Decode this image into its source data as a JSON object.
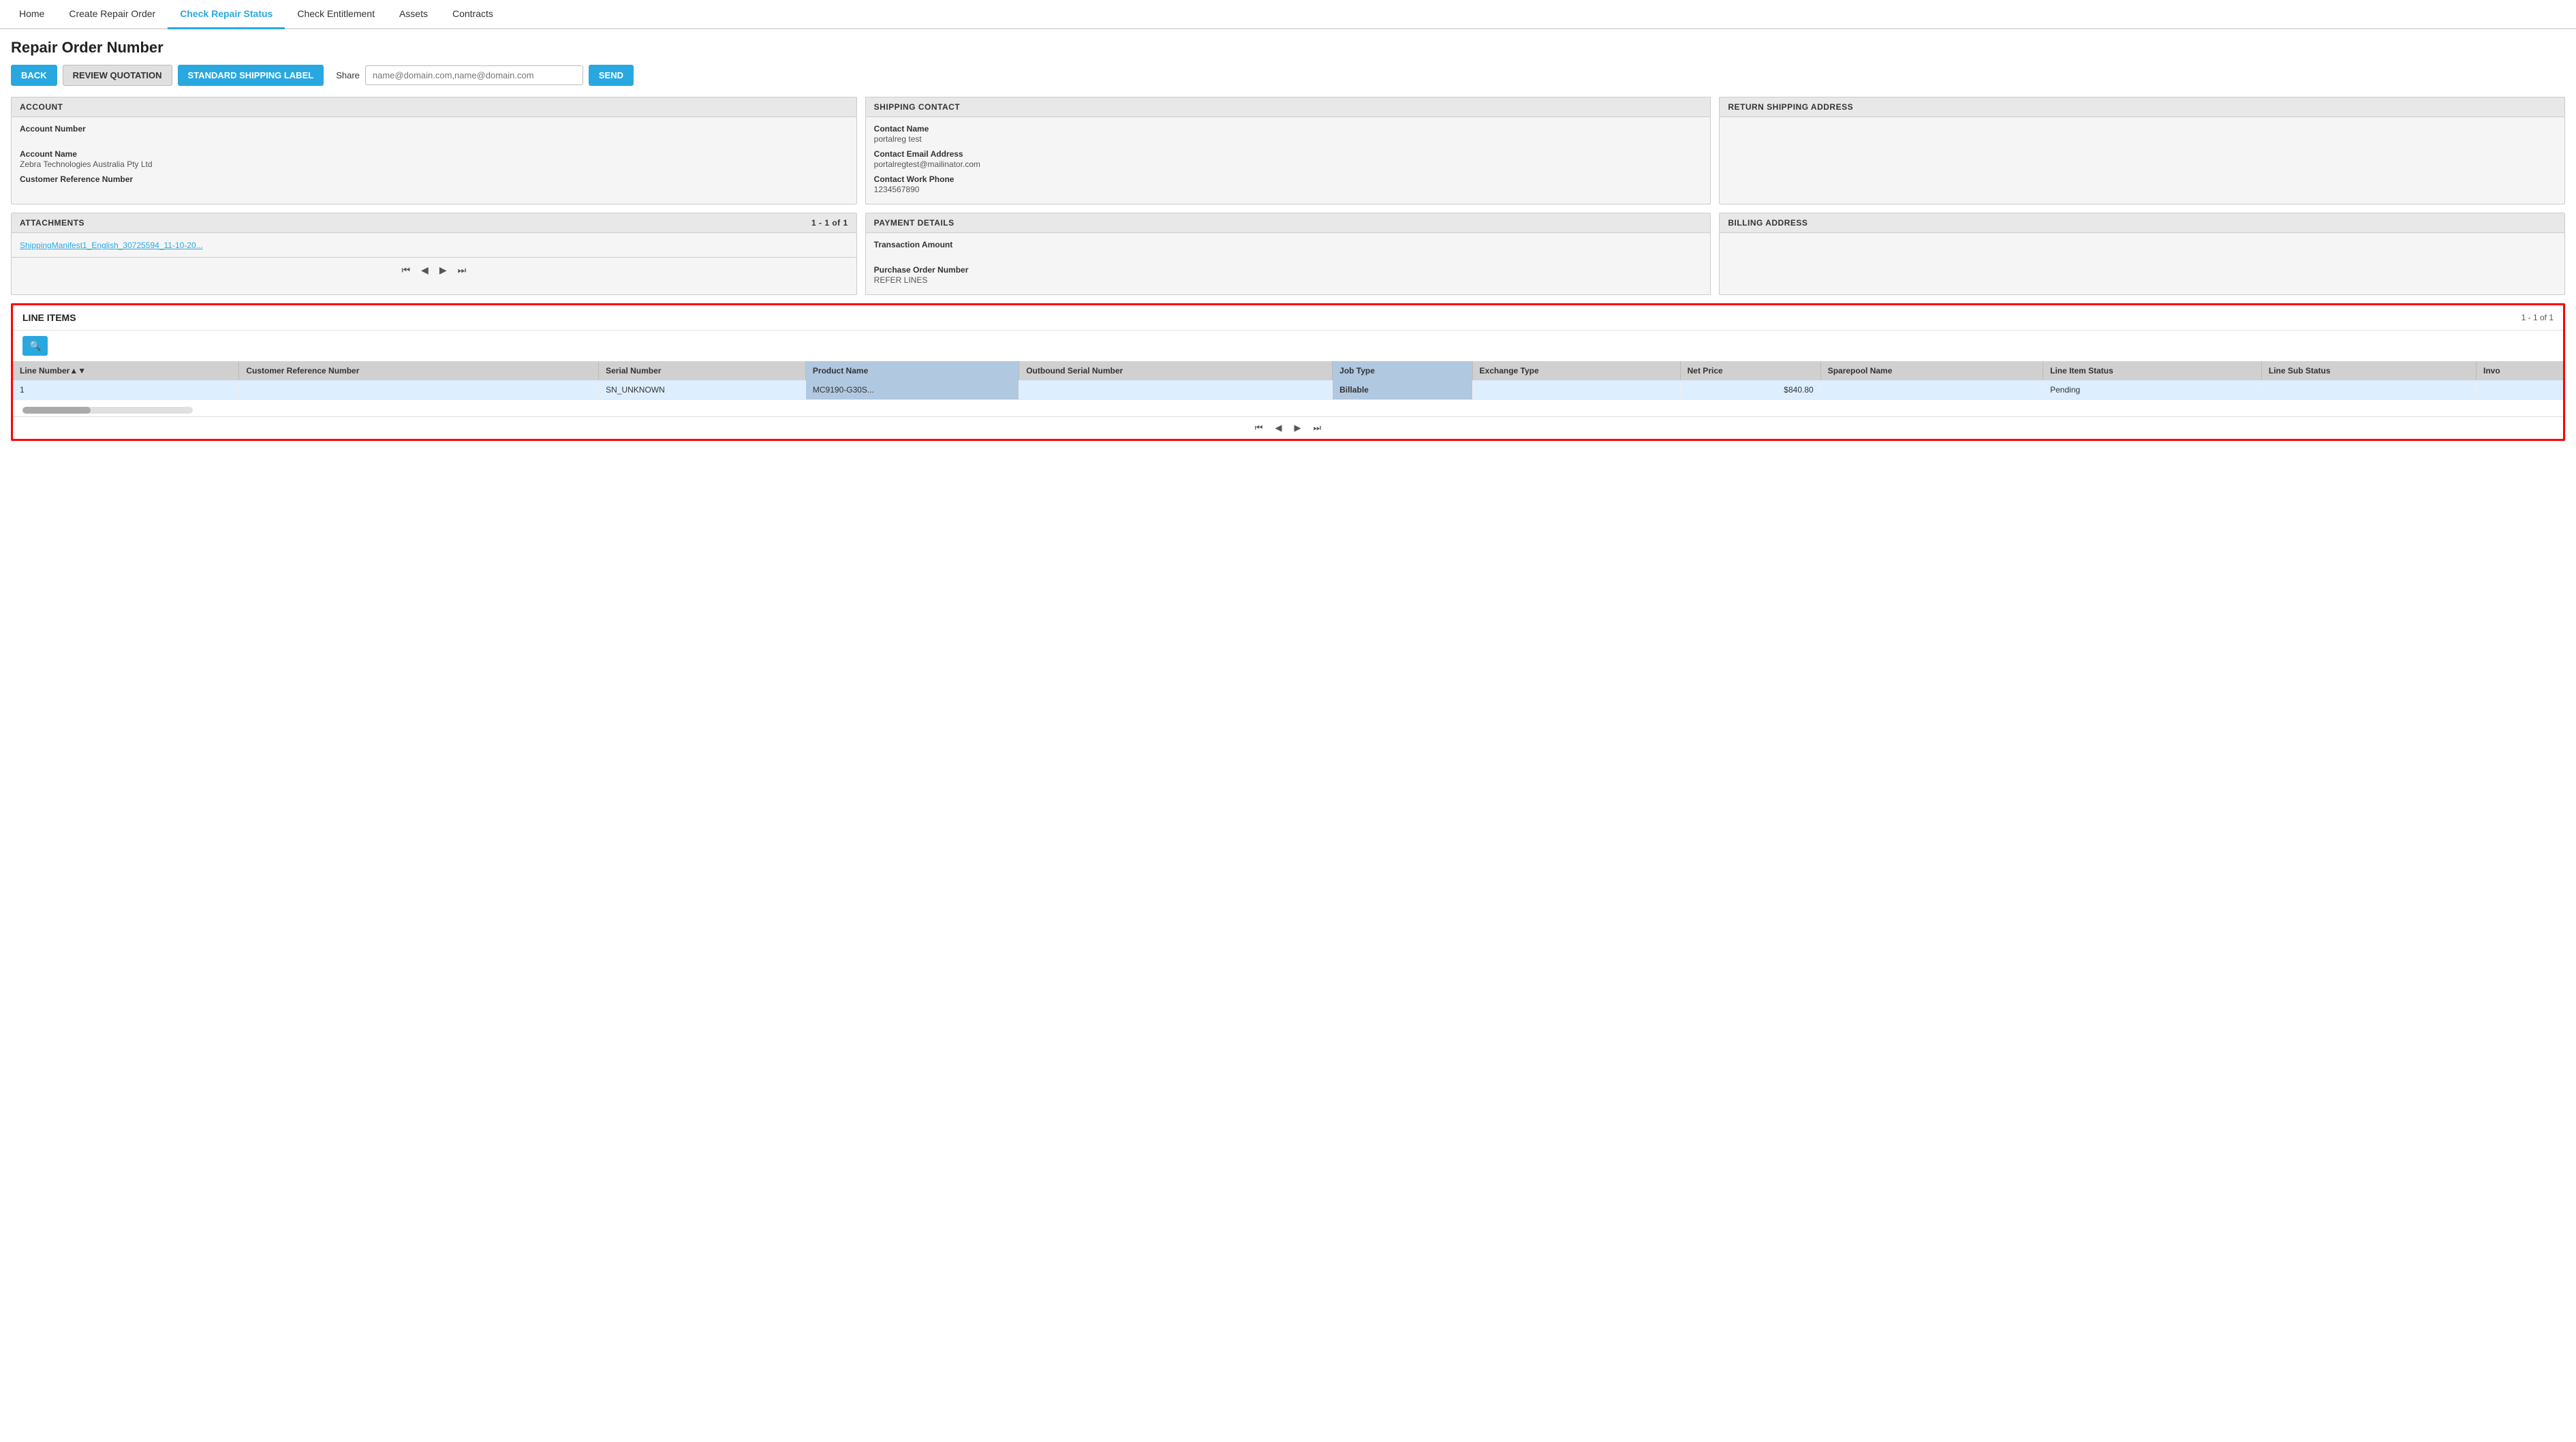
{
  "nav": {
    "items": [
      {
        "id": "home",
        "label": "Home",
        "active": false
      },
      {
        "id": "create-repair-order",
        "label": "Create Repair Order",
        "active": false
      },
      {
        "id": "check-repair-status",
        "label": "Check Repair Status",
        "active": true
      },
      {
        "id": "check-entitlement",
        "label": "Check Entitlement",
        "active": false
      },
      {
        "id": "assets",
        "label": "Assets",
        "active": false
      },
      {
        "id": "contracts",
        "label": "Contracts",
        "active": false
      }
    ]
  },
  "page": {
    "title": "Repair Order Number"
  },
  "toolbar": {
    "back_label": "BACK",
    "review_label": "REVIEW QUOTATION",
    "shipping_label": "STANDARD SHIPPING LABEL",
    "share_label": "Share",
    "share_placeholder": "name@domain.com,name@domain.com",
    "send_label": "SEND"
  },
  "account_panel": {
    "header": "ACCOUNT",
    "fields": [
      {
        "label": "Account Number",
        "value": ""
      },
      {
        "label": "Account Name",
        "value": "Zebra Technologies Australia Pty Ltd"
      },
      {
        "label": "Customer Reference Number",
        "value": ""
      }
    ]
  },
  "shipping_contact_panel": {
    "header": "SHIPPING CONTACT",
    "fields": [
      {
        "label": "Contact Name",
        "value": "portalreg test"
      },
      {
        "label": "Contact Email Address",
        "value": "portalregtest@mailinator.com"
      },
      {
        "label": "Contact Work Phone",
        "value": "1234567890"
      }
    ]
  },
  "return_shipping_panel": {
    "header": "RETURN SHIPPING ADDRESS",
    "fields": []
  },
  "attachments_panel": {
    "header": "ATTACHMENTS",
    "count": "1 - 1 of 1",
    "attachment_link": "ShippingManifest1_English_30725594_11-10-20..."
  },
  "payment_panel": {
    "header": "PAYMENT DETAILS",
    "fields": [
      {
        "label": "Transaction Amount",
        "value": ""
      },
      {
        "label": "Purchase Order Number",
        "value": "REFER LINES"
      }
    ]
  },
  "billing_panel": {
    "header": "BILLING ADDRESS",
    "fields": []
  },
  "line_items": {
    "title": "LINE ITEMS",
    "count": "1 - 1 of 1",
    "columns": [
      {
        "id": "line-number",
        "label": "Line Number▲▼",
        "highlighted": false
      },
      {
        "id": "customer-ref",
        "label": "Customer Reference Number",
        "highlighted": false
      },
      {
        "id": "serial-number",
        "label": "Serial Number",
        "highlighted": false
      },
      {
        "id": "product-name",
        "label": "Product Name",
        "highlighted": true
      },
      {
        "id": "outbound-serial",
        "label": "Outbound Serial Number",
        "highlighted": false
      },
      {
        "id": "job-type",
        "label": "Job Type",
        "highlighted": true
      },
      {
        "id": "exchange-type",
        "label": "Exchange Type",
        "highlighted": false
      },
      {
        "id": "net-price",
        "label": "Net Price",
        "highlighted": false
      },
      {
        "id": "sparepool-name",
        "label": "Sparepool Name",
        "highlighted": false
      },
      {
        "id": "line-item-status",
        "label": "Line Item Status",
        "highlighted": false
      },
      {
        "id": "line-sub-status",
        "label": "Line Sub Status",
        "highlighted": false
      },
      {
        "id": "invo",
        "label": "Invo",
        "highlighted": false
      }
    ],
    "rows": [
      {
        "line_number": "1",
        "customer_ref": "",
        "serial_number": "SN_UNKNOWN",
        "product_name": "MC9190-G30S...",
        "outbound_serial": "",
        "job_type": "Billable",
        "exchange_type": "",
        "net_price": "$840.80",
        "sparepool_name": "",
        "line_item_status": "Pending",
        "line_sub_status": "",
        "invo": ""
      }
    ]
  }
}
